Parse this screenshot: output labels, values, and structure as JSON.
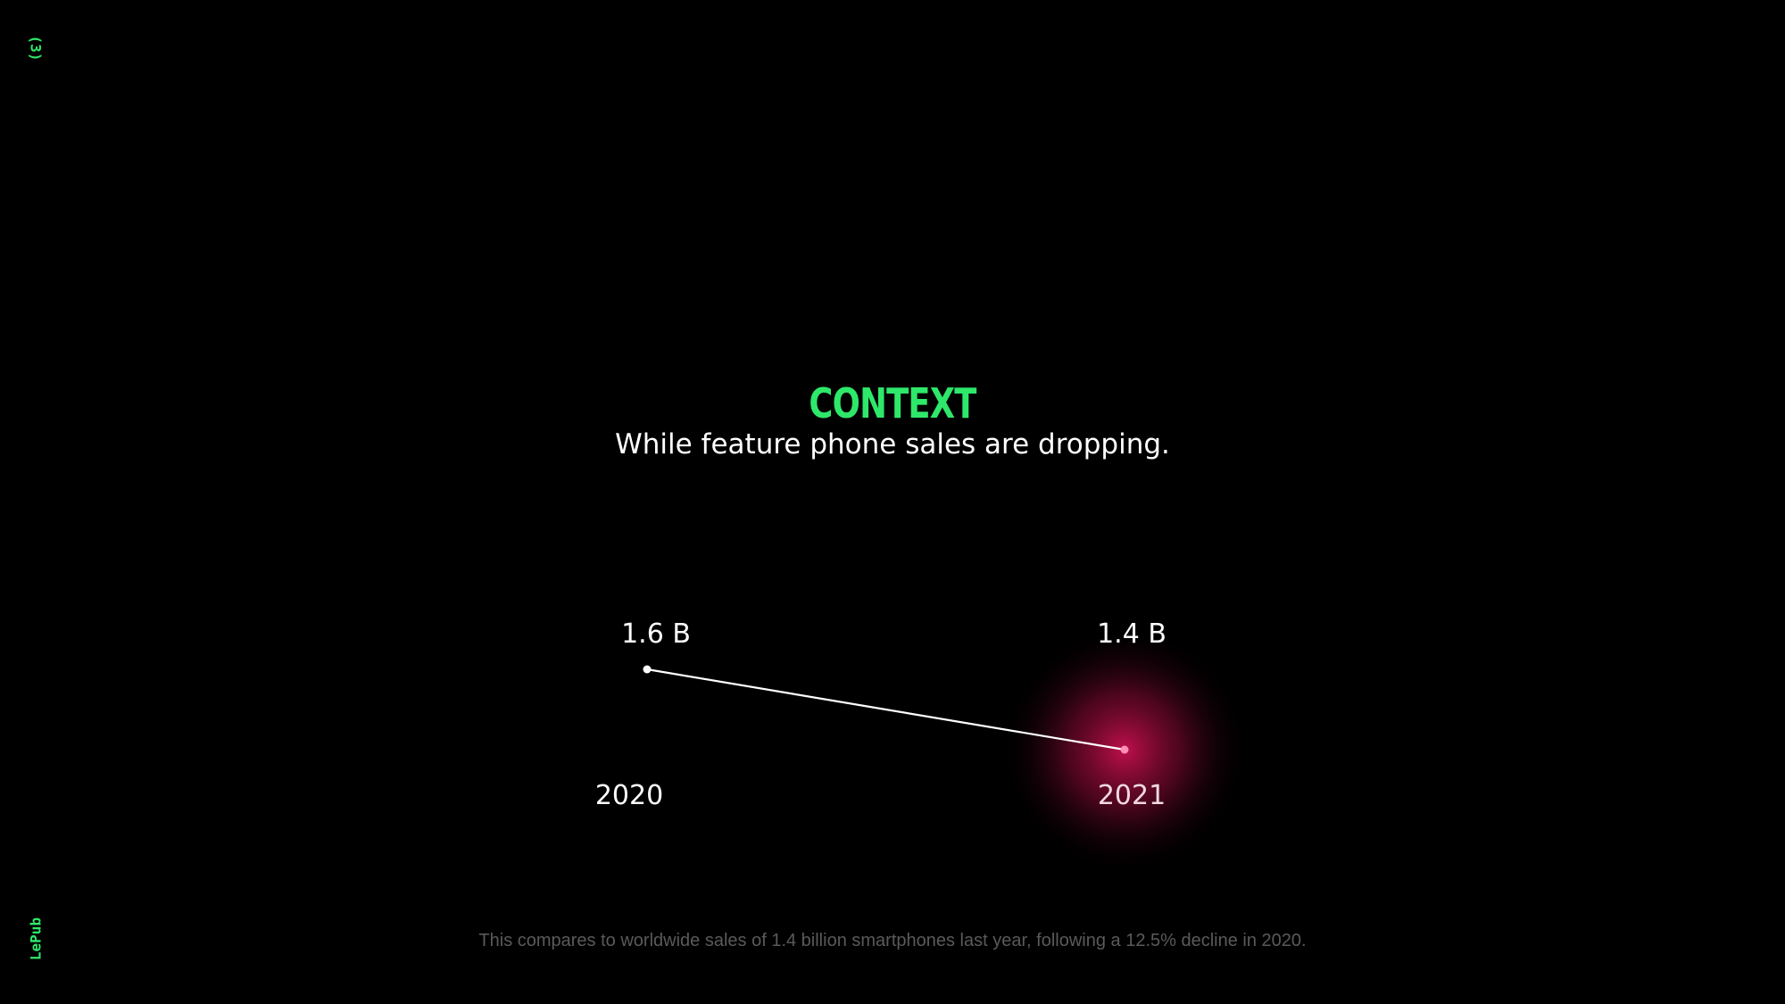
{
  "page": {
    "page_number": "(3)",
    "brand": "LePub",
    "heading": "CONTEXT",
    "subheading": "While feature phone sales are dropping.",
    "footnote": "This compares to worldwide sales of 1.4 billion smartphones last year, following a 12.5% decline in 2020."
  },
  "colors": {
    "background": "#000000",
    "accent_green": "#2ee86a",
    "line": "#ffffff",
    "highlight_glow": "#c8104f",
    "highlight_point": "#ff8fb8",
    "footnote": "#5a5a5a"
  },
  "chart_data": {
    "type": "line",
    "categories": [
      "2020",
      "2021"
    ],
    "values": [
      1.6,
      1.4
    ],
    "value_labels": [
      "1.6 B",
      "1.4 B"
    ],
    "highlight_index": 1,
    "axes_visible": false,
    "grid": false,
    "legend": "none"
  }
}
